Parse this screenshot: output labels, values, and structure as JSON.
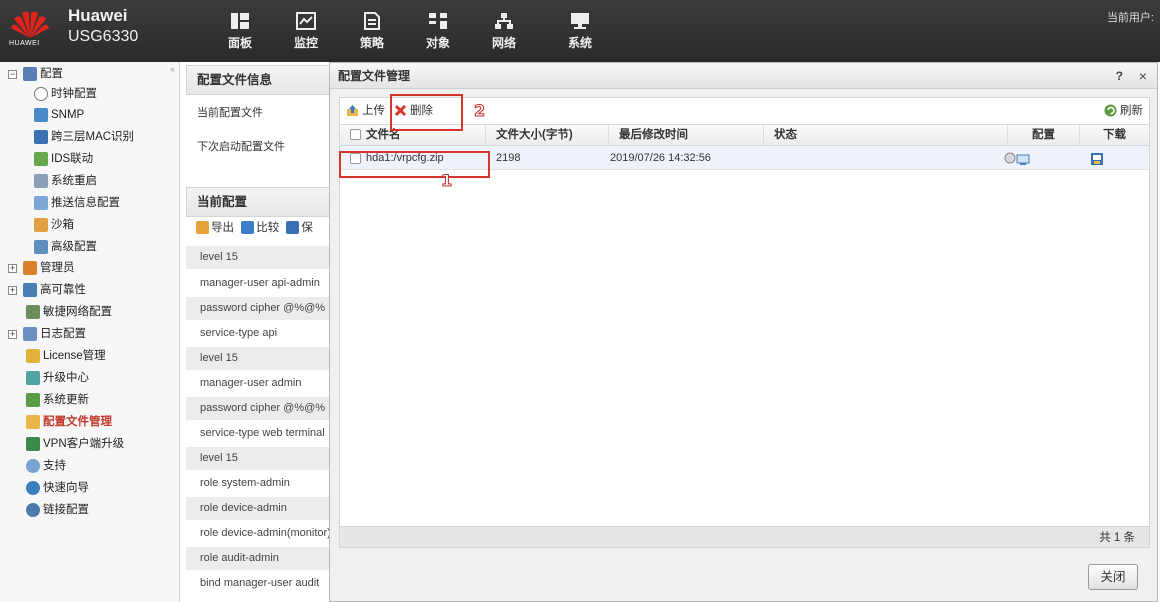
{
  "header": {
    "brand": "Huawei",
    "model": "USG6330",
    "logo_word": "HUAWEI",
    "nav": [
      {
        "label": "面板",
        "icon": "dashboard-icon"
      },
      {
        "label": "监控",
        "icon": "monitor-icon"
      },
      {
        "label": "策略",
        "icon": "policy-icon"
      },
      {
        "label": "对象",
        "icon": "object-icon"
      },
      {
        "label": "网络",
        "icon": "network-icon"
      },
      {
        "label": "系统",
        "icon": "system-icon"
      }
    ],
    "current_user_label": "当前用户:"
  },
  "sidebar": {
    "items": [
      {
        "label": "配置",
        "expander": "−"
      },
      {
        "label": "时钟配置"
      },
      {
        "label": "SNMP"
      },
      {
        "label": "跨三层MAC识别"
      },
      {
        "label": "IDS联动"
      },
      {
        "label": "系统重启"
      },
      {
        "label": "推送信息配置"
      },
      {
        "label": "沙箱"
      },
      {
        "label": "高级配置"
      },
      {
        "label": "管理员",
        "expander": "+"
      },
      {
        "label": "高可靠性",
        "expander": "+"
      },
      {
        "label": "敏捷网络配置"
      },
      {
        "label": "日志配置",
        "expander": "+"
      },
      {
        "label": "License管理"
      },
      {
        "label": "升级中心"
      },
      {
        "label": "系统更新"
      },
      {
        "label": "配置文件管理",
        "active": true
      },
      {
        "label": "VPN客户端升级"
      },
      {
        "label": "支持"
      },
      {
        "label": "快速向导"
      },
      {
        "label": "链接配置"
      }
    ]
  },
  "mid": {
    "config_info_title": "配置文件信息",
    "current_config_file_label": "当前配置文件",
    "next_startup_label": "下次启动配置文件",
    "current_config_title": "当前配置",
    "toolbar": {
      "export": "导出",
      "compare": "比较",
      "save": "保"
    },
    "lines": [
      "level 15",
      "manager-user api-admin",
      "password cipher @%@%",
      "service-type api",
      "level 15",
      "manager-user admin",
      "password cipher @%@%",
      "service-type web terminal",
      "level 15",
      "role system-admin",
      "role device-admin",
      "role device-admin(monitor)",
      "role audit-admin",
      "bind manager-user audit"
    ]
  },
  "dialog": {
    "title": "配置文件管理",
    "help": "?",
    "close": "×",
    "toolbar": {
      "upload": "上传",
      "delete": "删除",
      "refresh": "刷新"
    },
    "columns": {
      "filename": "文件名",
      "size": "文件大小(字节)",
      "modified": "最后修改时间",
      "status": "状态",
      "config": "配置",
      "download": "下载"
    },
    "rows": [
      {
        "filename": "hda1:/vrpcfg.zip",
        "size": "2198",
        "modified": "2019/07/26 14:32:56",
        "status": ""
      }
    ],
    "total": "共 1 条",
    "close_button": "关闭"
  },
  "annotations": [
    {
      "number": "1",
      "color": "#d9342b"
    },
    {
      "number": "2",
      "color": "#d9342b"
    }
  ]
}
